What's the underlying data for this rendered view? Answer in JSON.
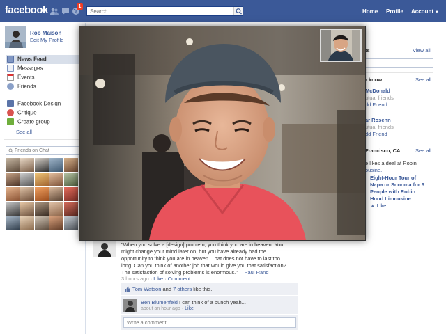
{
  "header": {
    "logo": "facebook",
    "notifications_count": "1",
    "search_placeholder": "Search",
    "nav": [
      "Home",
      "Profile",
      "Account"
    ]
  },
  "profile": {
    "name": "Rob Maison",
    "edit": "Edit My Profile"
  },
  "sidebar": {
    "items": [
      {
        "label": "News Feed",
        "icon": "news-feed-icon"
      },
      {
        "label": "Messages",
        "icon": "messages-icon"
      },
      {
        "label": "Events",
        "icon": "events-icon"
      },
      {
        "label": "Friends",
        "icon": "friends-icon"
      }
    ],
    "groups": [
      {
        "label": "Facebook Design",
        "icon": "group-icon"
      },
      {
        "label": "Critique",
        "icon": "group-heart-icon"
      },
      {
        "label": "Create group",
        "icon": "create-group-icon"
      }
    ],
    "see_all": "See all",
    "chat_search_placeholder": "Friends on Chat"
  },
  "right": {
    "events_suffix": "ts",
    "events_see_all": "View all",
    "people_header": "r know",
    "people_see_all": "See all",
    "person1_name": "McDonald",
    "person1_mutual": "utual friends",
    "person1_add": "dd Friend",
    "person2_name": "ar Rosenn",
    "person2_mutual": "utual friends",
    "person2_add": "dd Friend",
    "deal_header": "Francisco, CA",
    "deal_see_all": "See all",
    "deal_line1": "e likes a deal at Robin",
    "deal_line2": "ousine.",
    "deal_title_1": "Eight-Hour Tour of",
    "deal_title_2": "Napa or Sonoma for 6",
    "deal_title_3": "People with Robin",
    "deal_title_4": "Hood Limousine",
    "deal_like": "Like"
  },
  "feed": {
    "quote_1": "\"When you solve a [design] problem, you think you are in heaven. You",
    "quote_2": "might change your mind later on, but you have already had the",
    "quote_3": "opportunity to think you are in heaven. That does not have to last too",
    "quote_4": "long. Can you think of another job that would give you that satisfaction?",
    "quote_5": "The satisfaction of solving problems is enormous.\" —",
    "quote_author": "Paul Rand",
    "time": "3 hours ago",
    "like": "Like",
    "comment": "Comment",
    "likes_name": "Tom Watson",
    "likes_and": " and ",
    "likes_others": "7 others",
    "likes_suffix": " like this.",
    "comment_author": "Ben Blumenfeld",
    "comment_text": " I can think of a bunch yeah...",
    "comment_time": "about an hour ago",
    "comment_like": "Like",
    "write_placeholder": "Write a comment..."
  },
  "colors": {
    "brand": "#3b5998",
    "badge": "#f03d25",
    "shirt": "#e8525b"
  }
}
